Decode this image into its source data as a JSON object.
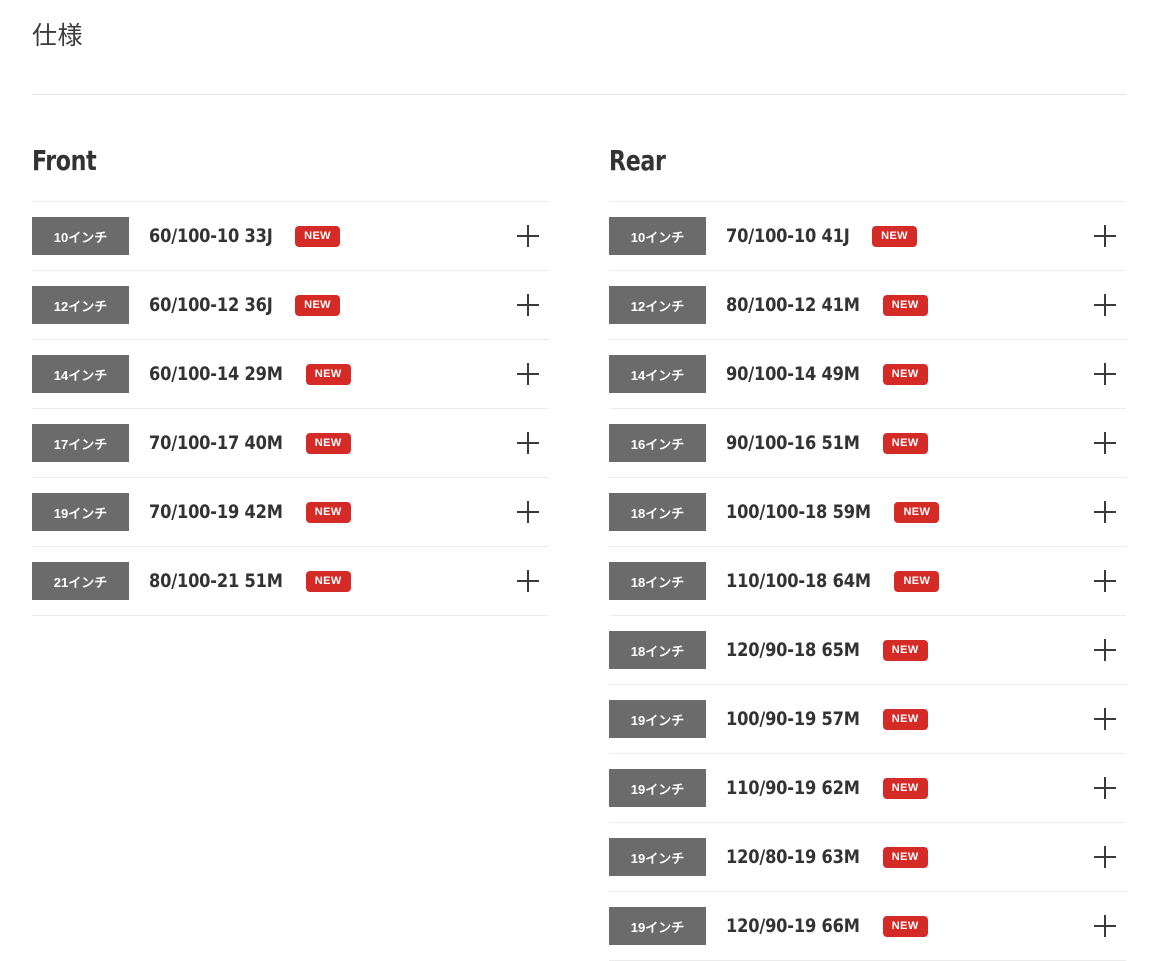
{
  "page": {
    "section_title": "仕様"
  },
  "columns": [
    {
      "key": "front",
      "title": "Front",
      "rows": [
        {
          "size": "10インチ",
          "spec": "60/100-10 33J",
          "badge": "NEW",
          "toggle": "plus-icon"
        },
        {
          "size": "12インチ",
          "spec": "60/100-12 36J",
          "badge": "NEW",
          "toggle": "plus-icon"
        },
        {
          "size": "14インチ",
          "spec": "60/100-14 29M",
          "badge": "NEW",
          "toggle": "plus-icon"
        },
        {
          "size": "17インチ",
          "spec": "70/100-17 40M",
          "badge": "NEW",
          "toggle": "plus-icon"
        },
        {
          "size": "19インチ",
          "spec": "70/100-19 42M",
          "badge": "NEW",
          "toggle": "plus-icon"
        },
        {
          "size": "21インチ",
          "spec": "80/100-21 51M",
          "badge": "NEW",
          "toggle": "plus-icon"
        }
      ]
    },
    {
      "key": "rear",
      "title": "Rear",
      "rows": [
        {
          "size": "10インチ",
          "spec": "70/100-10 41J",
          "badge": "NEW",
          "toggle": "plus-icon"
        },
        {
          "size": "12インチ",
          "spec": "80/100-12 41M",
          "badge": "NEW",
          "toggle": "plus-icon"
        },
        {
          "size": "14インチ",
          "spec": "90/100-14 49M",
          "badge": "NEW",
          "toggle": "plus-icon"
        },
        {
          "size": "16インチ",
          "spec": "90/100-16 51M",
          "badge": "NEW",
          "toggle": "plus-icon"
        },
        {
          "size": "18インチ",
          "spec": "100/100-18 59M",
          "badge": "NEW",
          "toggle": "plus-icon"
        },
        {
          "size": "18インチ",
          "spec": "110/100-18 64M",
          "badge": "NEW",
          "toggle": "plus-icon"
        },
        {
          "size": "18インチ",
          "spec": "120/90-18 65M",
          "badge": "NEW",
          "toggle": "plus-icon"
        },
        {
          "size": "19インチ",
          "spec": "100/90-19 57M",
          "badge": "NEW",
          "toggle": "plus-icon"
        },
        {
          "size": "19インチ",
          "spec": "110/90-19 62M",
          "badge": "NEW",
          "toggle": "plus-icon"
        },
        {
          "size": "19インチ",
          "spec": "120/80-19 63M",
          "badge": "NEW",
          "toggle": "plus-icon"
        },
        {
          "size": "19インチ",
          "spec": "120/90-19 66M",
          "badge": "NEW",
          "toggle": "plus-icon"
        }
      ]
    }
  ],
  "colors": {
    "badge_red": "#d42b27",
    "chip_grey": "#6b6b6b",
    "text_dark": "#333333",
    "rule_grey": "#ececec",
    "background": "#ffffff"
  }
}
